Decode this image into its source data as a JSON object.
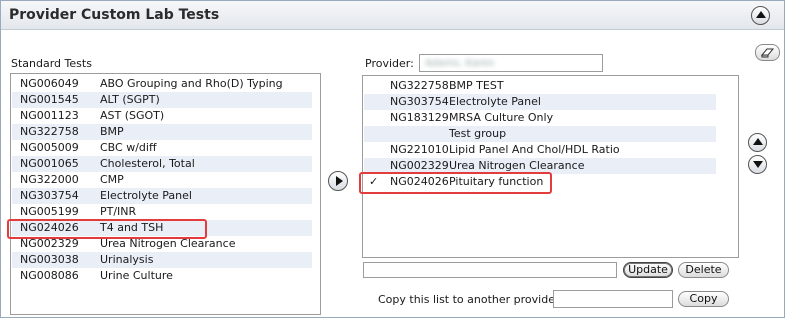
{
  "header": {
    "title": "Provider Custom Lab Tests"
  },
  "standard": {
    "label": "Standard Tests",
    "items": [
      {
        "code": "NG006049",
        "name": "ABO Grouping and Rho(D) Typing"
      },
      {
        "code": "NG001545",
        "name": "ALT (SGPT)"
      },
      {
        "code": "NG001123",
        "name": "AST (SGOT)"
      },
      {
        "code": "NG322758",
        "name": "BMP"
      },
      {
        "code": "NG005009",
        "name": "CBC w/diff"
      },
      {
        "code": "NG001065",
        "name": "Cholesterol, Total"
      },
      {
        "code": "NG322000",
        "name": "CMP"
      },
      {
        "code": "NG303754",
        "name": "Electrolyte Panel"
      },
      {
        "code": "NG005199",
        "name": "PT/INR"
      },
      {
        "code": "NG024026",
        "name": "T4 and TSH"
      },
      {
        "code": "NG002329",
        "name": "Urea Nitrogen Clearance"
      },
      {
        "code": "NG003038",
        "name": "Urinalysis"
      },
      {
        "code": "NG008086",
        "name": "Urine Culture"
      }
    ]
  },
  "provider": {
    "label": "Provider:",
    "value": "Adams, Karen",
    "items": [
      {
        "check": "",
        "code": "NG322758",
        "name": "BMP TEST"
      },
      {
        "check": "",
        "code": "NG303754",
        "name": "Electrolyte Panel"
      },
      {
        "check": "",
        "code": "NG183129",
        "name": "MRSA Culture Only"
      },
      {
        "check": "",
        "code": "",
        "name": "Test group"
      },
      {
        "check": "",
        "code": "NG221010",
        "name": "Lipid Panel And Chol/HDL Ratio"
      },
      {
        "check": "",
        "code": "NG002329",
        "name": "Urea Nitrogen Clearance"
      },
      {
        "check": "✓",
        "code": "NG024026",
        "name": "Pituitary function"
      }
    ]
  },
  "actions": {
    "update": "Update",
    "delete": "Delete",
    "copy_label": "Copy this list to another provider",
    "copy": "Copy"
  }
}
